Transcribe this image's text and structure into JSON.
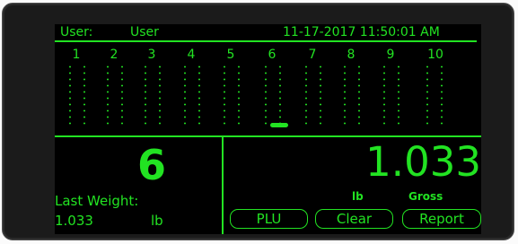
{
  "header": {
    "user_label": "User:",
    "user_value": "User",
    "datetime": "11-17-2017 11:50:01 AM"
  },
  "channels": [
    "1",
    "2",
    "3",
    "4",
    "5",
    "6",
    "7",
    "8",
    "9",
    "10"
  ],
  "selected_channel_marker": "6",
  "left_panel": {
    "channel_number": "6",
    "last_weight_label": "Last Weight:",
    "last_weight_value": "1.033",
    "last_weight_unit": "lb"
  },
  "right_panel": {
    "weight": "1.033",
    "unit": "lb",
    "mode": "Gross"
  },
  "buttons": {
    "plu": "PLU",
    "clear": "Clear",
    "report": "Report"
  },
  "colors": {
    "display_green": "#22e322",
    "screen_bg": "#000000",
    "bezel": "#1b1b1b"
  }
}
